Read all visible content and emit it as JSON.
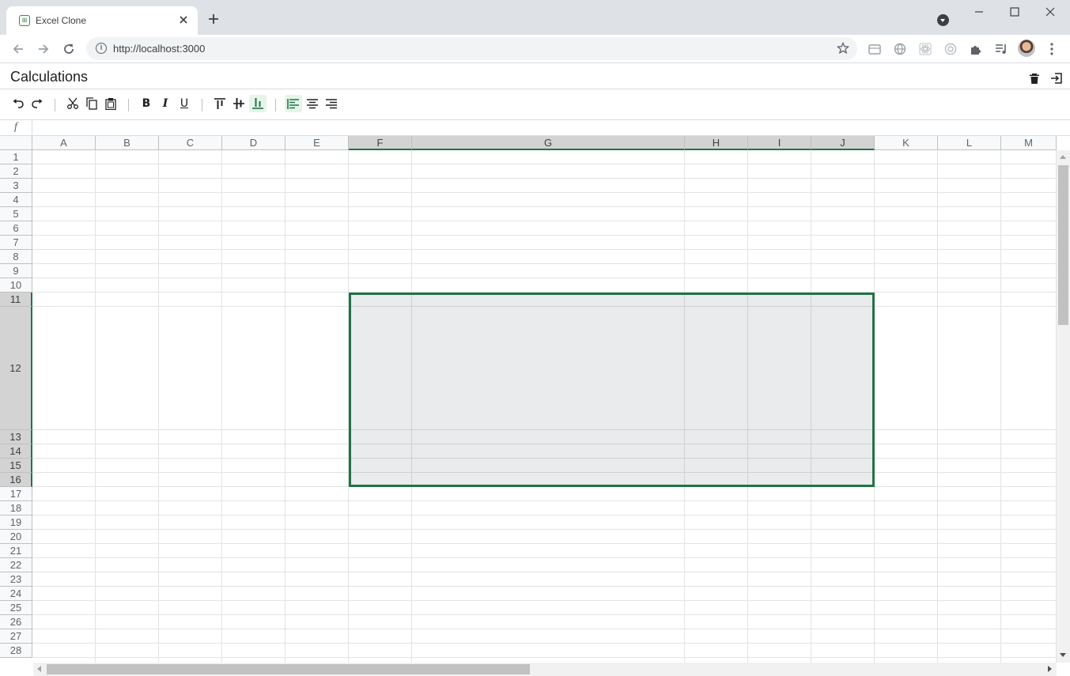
{
  "browser": {
    "tab_title": "Excel Clone",
    "url": "http://localhost:3000",
    "favicon_icon": "excel-clone-favicon-icon"
  },
  "app": {
    "sheet_title": "Calculations",
    "header_icons": [
      "trash-icon",
      "exit-icon"
    ]
  },
  "toolbar": {
    "groups": [
      [
        "undo-icon",
        "redo-icon"
      ],
      [
        "cut-icon",
        "copy-icon",
        "paste-icon"
      ],
      [
        "bold",
        "italic",
        "underline"
      ],
      [
        "vertical-align-top-icon",
        "vertical-align-middle-icon",
        "vertical-align-bottom-icon"
      ],
      [
        "align-left-icon",
        "align-center-icon",
        "align-right-icon"
      ]
    ],
    "bold_label": "B",
    "italic_label": "I",
    "underline_label": "U",
    "active_vertical_align": "bottom",
    "active_horizontal_align": "left",
    "accent_color": "#217346"
  },
  "formula": {
    "label": "f",
    "value": ""
  },
  "grid": {
    "columns": [
      "A",
      "B",
      "C",
      "D",
      "E",
      "F",
      "G",
      "H",
      "I",
      "J",
      "K",
      "L",
      "M"
    ],
    "rows": [
      "1",
      "2",
      "3",
      "4",
      "5",
      "6",
      "7",
      "8",
      "9",
      "10",
      "11",
      "12",
      "13",
      "14",
      "15",
      "16",
      "17",
      "18",
      "19",
      "20",
      "21",
      "22",
      "23",
      "24",
      "25",
      "26",
      "27",
      "28"
    ],
    "selected_columns": [
      "F",
      "G",
      "H",
      "I",
      "J"
    ],
    "selected_rows": [
      "11",
      "12",
      "13",
      "14",
      "15",
      "16"
    ],
    "selection_range": "F11:J16",
    "selection_border_color": "#217346"
  }
}
